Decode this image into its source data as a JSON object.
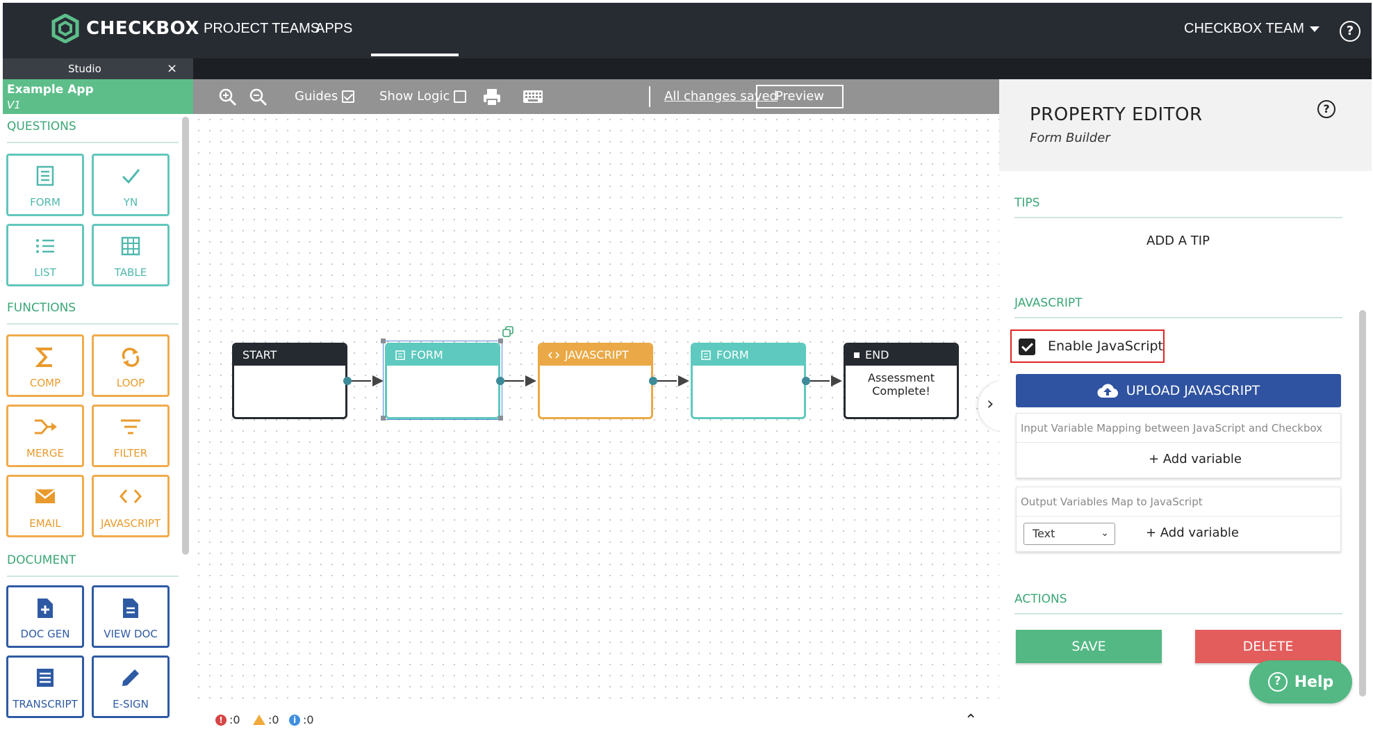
{
  "brand": {
    "name": "CHECKBOX",
    "color": "#5dbe8a"
  },
  "nav": {
    "items": [
      "PROJECT TEAMS",
      "APPS"
    ],
    "active": "APPS",
    "team": "CHECKBOX TEAM",
    "help_icon": "question-circle-icon"
  },
  "studio": {
    "tab_label": "Studio",
    "close": "×"
  },
  "app": {
    "name": "Example App",
    "version": "V1"
  },
  "sidebar": {
    "sections": [
      {
        "title": "QUESTIONS",
        "tiles": [
          {
            "label": "FORM",
            "icon": "form-icon"
          },
          {
            "label": "YN",
            "icon": "check-icon"
          },
          {
            "label": "LIST",
            "icon": "list-icon"
          },
          {
            "label": "TABLE",
            "icon": "table-icon"
          }
        ]
      },
      {
        "title": "FUNCTIONS",
        "tiles": [
          {
            "label": "COMP",
            "icon": "sigma-icon"
          },
          {
            "label": "LOOP",
            "icon": "loop-icon"
          },
          {
            "label": "MERGE",
            "icon": "merge-icon"
          },
          {
            "label": "FILTER",
            "icon": "filter-icon"
          },
          {
            "label": "EMAIL",
            "icon": "email-icon"
          },
          {
            "label": "JAVASCRIPT",
            "icon": "code-icon"
          }
        ]
      },
      {
        "title": "DOCUMENT",
        "tiles": [
          {
            "label": "DOC GEN",
            "icon": "doc-plus-icon"
          },
          {
            "label": "VIEW DOC",
            "icon": "doc-icon"
          },
          {
            "label": "TRANSCRIPT",
            "icon": "transcript-icon"
          },
          {
            "label": "E-SIGN",
            "icon": "pen-icon"
          }
        ]
      }
    ]
  },
  "toolbar": {
    "guides": "Guides",
    "guides_checked": true,
    "show_logic": "Show Logic",
    "show_logic_checked": false,
    "preview": "Preview",
    "saved": "All changes saved"
  },
  "flow": {
    "nodes": [
      {
        "title": "START",
        "kind": "start",
        "body": ""
      },
      {
        "title": "FORM",
        "kind": "form",
        "body": "",
        "selected": true
      },
      {
        "title": "JAVASCRIPT",
        "kind": "javascript",
        "body": ""
      },
      {
        "title": "FORM",
        "kind": "form",
        "body": ""
      },
      {
        "title": "END",
        "kind": "end",
        "body_line1": "Assessment",
        "body_line2": "Complete!"
      }
    ]
  },
  "status": {
    "errors": ":0",
    "warnings": ":0",
    "info": ":0"
  },
  "property_editor": {
    "title": "PROPERTY EDITOR",
    "subtitle": "Form Builder",
    "tips_heading": "TIPS",
    "add_tip": "ADD A TIP",
    "js_heading": "JAVASCRIPT",
    "enable_js_label": "Enable JavaScript",
    "enable_js_checked": true,
    "upload_label": "UPLOAD JAVASCRIPT",
    "input_caption": "Input Variable Mapping between JavaScript and Checkbox",
    "input_add": "+ Add variable",
    "output_caption": "Output Variables Map to JavaScript",
    "output_type": "Text",
    "output_add": "+ Add variable",
    "actions_heading": "ACTIONS",
    "save": "SAVE",
    "delete": "DELETE"
  },
  "help_fab": "Help"
}
